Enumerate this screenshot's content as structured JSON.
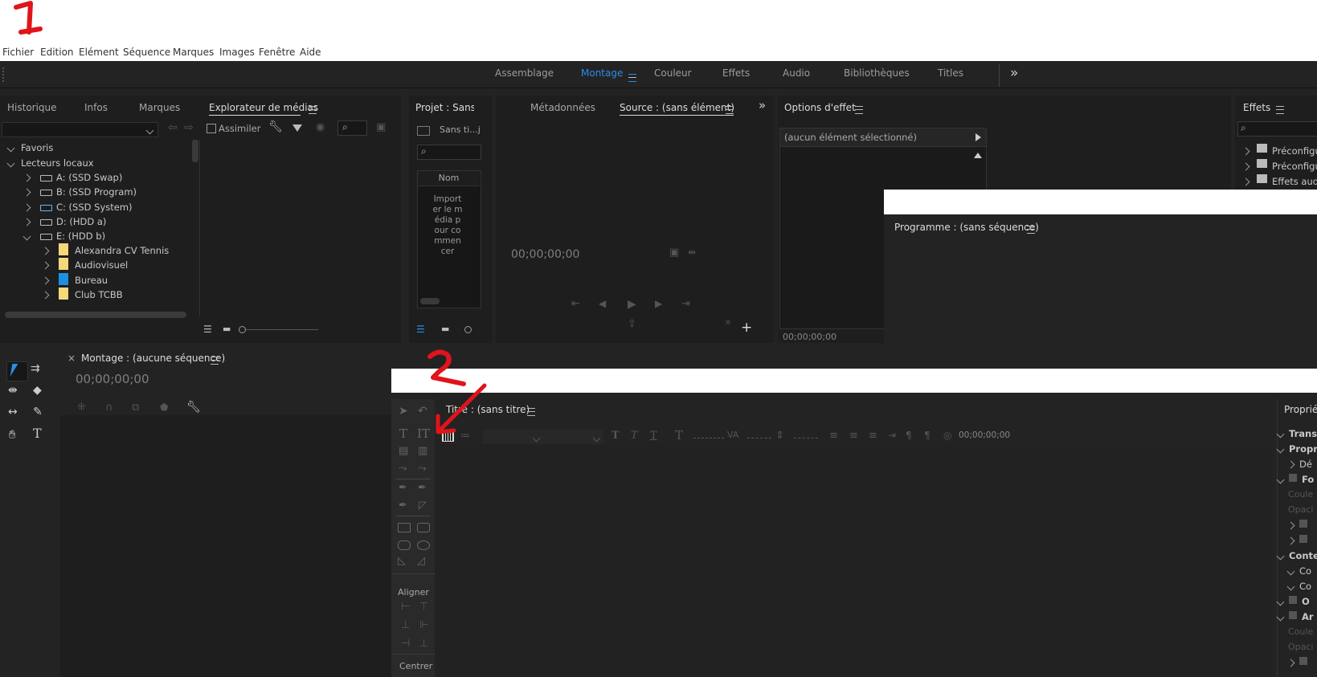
{
  "annotations": {
    "step1": "1",
    "step2": "2"
  },
  "menu": [
    "Fichier",
    "Edition",
    "Elément",
    "Séquence",
    "Marques",
    "Images",
    "Fenêtre",
    "Aide"
  ],
  "workspaces": {
    "items": [
      "Assemblage",
      "Montage",
      "Couleur",
      "Effets",
      "Audio",
      "Bibliothèques",
      "Titles"
    ],
    "active": "Montage",
    "overflow": "»"
  },
  "left_panel": {
    "tabs": [
      "Historique",
      "Infos",
      "Marques",
      "Explorateur de médias"
    ],
    "assimiler": "Assimiler",
    "tree": [
      {
        "label": "Favoris",
        "level": 0,
        "icon": "none"
      },
      {
        "label": "Lecteurs locaux",
        "level": 0,
        "icon": "none"
      },
      {
        "label": "A: (SSD Swap)",
        "level": 1,
        "icon": "drive-icon"
      },
      {
        "label": "B: (SSD Program)",
        "level": 1,
        "icon": "drive-icon"
      },
      {
        "label": "C: (SSD System)",
        "level": 1,
        "icon": "system-drive-icon"
      },
      {
        "label": "D: (HDD a)",
        "level": 1,
        "icon": "drive-icon"
      },
      {
        "label": "E: (HDD b)",
        "level": 1,
        "icon": "drive-icon"
      },
      {
        "label": "Alexandra CV Tennis",
        "level": 2,
        "icon": "folder-icon"
      },
      {
        "label": "Audiovisuel",
        "level": 2,
        "icon": "folder-icon"
      },
      {
        "label": "Bureau",
        "level": 2,
        "icon": "desktop-folder-icon"
      },
      {
        "label": "Club TCBB",
        "level": 2,
        "icon": "folder-icon"
      }
    ]
  },
  "project_panel": {
    "title": "Projet : Sans ti",
    "project_name": "Sans ti...j",
    "column": "Nom",
    "empty_msg": "Importer le média pour commencer"
  },
  "source_panel": {
    "tabs": [
      "Métadonnées",
      "Source : (sans élément)"
    ],
    "timecode": "00;00;00;00",
    "overflow": "»",
    "add": "+"
  },
  "effect_options": {
    "title": "Options d'effet",
    "no_selection": "(aucun élément sélectionné)",
    "timecode": "00;00;00;00"
  },
  "effects_panel": {
    "title": "Effets",
    "items": [
      "Préconfigu",
      "Préconfigu",
      "Effets audi"
    ]
  },
  "program_panel": {
    "title": "Programme : (sans séquence)"
  },
  "timeline": {
    "close": "×",
    "title": "Montage : (aucune séquence)",
    "timecode": "00;00;00;00"
  },
  "titler": {
    "title": "Titre : (sans titre)",
    "timecode": "00;00;00;00",
    "align_label": "Aligner",
    "center_label": "Centrer"
  },
  "properties": {
    "title": "Proprié",
    "rows": [
      "Trans",
      "Propr",
      "Dé",
      "Fo",
      "Coule",
      "Opaci",
      "",
      "",
      "Conte",
      "Co",
      "Co",
      "O",
      "Ar",
      "Coule",
      "Opaci",
      ""
    ]
  },
  "colors": {
    "accent": "#2d8ceb",
    "annotation": "#e0141b"
  }
}
